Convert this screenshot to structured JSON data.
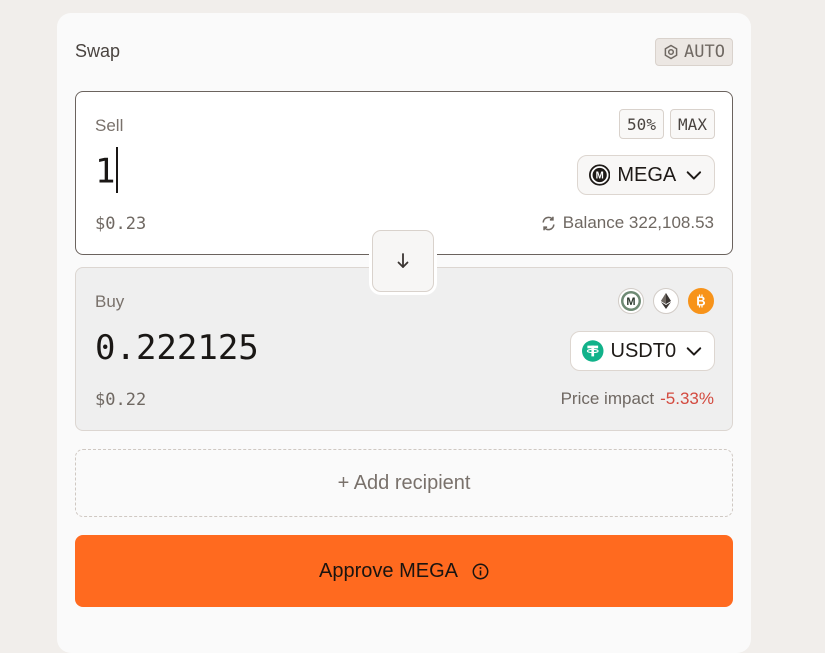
{
  "swap": {
    "title": "Swap",
    "auto_label": "AUTO"
  },
  "sell": {
    "label": "Sell",
    "pct_50": "50%",
    "max": "MAX",
    "amount": "1",
    "token": "MEGA",
    "usd_value": "$0.23",
    "balance_text": "Balance 322,108.53"
  },
  "buy": {
    "label": "Buy",
    "amount": "0.222125",
    "token": "USDT0",
    "usd_value": "$0.22",
    "price_impact_label": "Price impact",
    "price_impact_value": "-5.33%",
    "quick_tokens": [
      "mega-icon",
      "ethereum-icon",
      "bitcoin-icon"
    ]
  },
  "recipient": {
    "label": "+ Add recipient"
  },
  "action": {
    "label": "Approve MEGA"
  },
  "colors": {
    "accent": "#ff6a1f",
    "negative": "#d34a3f",
    "usdt0": "#11b28a",
    "bitcoin": "#f7931a"
  }
}
